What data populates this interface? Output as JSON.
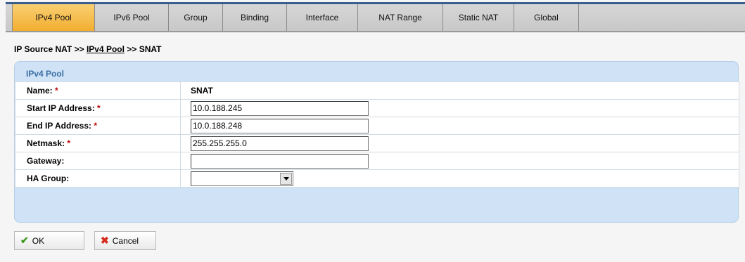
{
  "tabs": [
    {
      "label": "IPv4 Pool",
      "active": true
    },
    {
      "label": "IPv6 Pool",
      "active": false
    },
    {
      "label": "Group",
      "active": false
    },
    {
      "label": "Binding",
      "active": false
    },
    {
      "label": "Interface",
      "active": false
    },
    {
      "label": "NAT Range",
      "active": false
    },
    {
      "label": "Static NAT",
      "active": false
    },
    {
      "label": "Global",
      "active": false
    }
  ],
  "breadcrumb": {
    "root": "IP Source NAT",
    "sep1": ">>",
    "link": "IPv4 Pool",
    "sep2": ">>",
    "current": "SNAT"
  },
  "panel": {
    "title": "IPv4 Pool",
    "fields": {
      "name": {
        "label": "Name:",
        "required": "*",
        "value": "SNAT"
      },
      "start_ip": {
        "label": "Start IP Address:",
        "required": "*",
        "value": "10.0.188.245"
      },
      "end_ip": {
        "label": "End IP Address:",
        "required": "*",
        "value": "10.0.188.248"
      },
      "netmask": {
        "label": "Netmask:",
        "required": "*",
        "value": "255.255.255.0"
      },
      "gateway": {
        "label": "Gateway:",
        "value": ""
      },
      "ha_group": {
        "label": "HA Group:",
        "value": ""
      }
    }
  },
  "buttons": {
    "ok": {
      "label": "OK",
      "icon": "check-icon"
    },
    "cancel": {
      "label": "Cancel",
      "icon": "x-icon"
    }
  },
  "colors": {
    "active_tab": "#f2ae30",
    "panel_bg": "#cfe2f6",
    "panel_title": "#3b6ea5",
    "required": "#c00000",
    "ok_icon": "#3e9a1e",
    "cancel_icon": "#d62a1a"
  }
}
